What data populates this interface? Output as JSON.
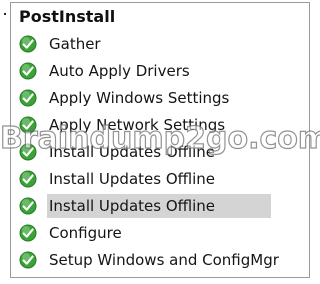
{
  "task_sequence": {
    "group_title": "PostInstall",
    "steps": [
      {
        "label": "Gather",
        "status_icon": "check-circle-icon",
        "selected": false
      },
      {
        "label": "Auto Apply Drivers",
        "status_icon": "check-circle-icon",
        "selected": false
      },
      {
        "label": "Apply Windows Settings",
        "status_icon": "check-circle-icon",
        "selected": false
      },
      {
        "label": "Apply Network Settings",
        "status_icon": "check-circle-icon",
        "selected": false
      },
      {
        "label": "Install Updates Offline",
        "status_icon": "check-circle-icon",
        "selected": false
      },
      {
        "label": "Install Updates Offline",
        "status_icon": "check-circle-icon",
        "selected": false
      },
      {
        "label": "Install Updates Offline",
        "status_icon": "check-circle-icon",
        "selected": true
      },
      {
        "label": "Configure",
        "status_icon": "check-circle-icon",
        "selected": false
      },
      {
        "label": "Setup Windows and ConfigMgr",
        "status_icon": "check-circle-icon",
        "selected": false
      }
    ],
    "selection_color": "#d4d4d4",
    "icon_color": "#3aa336"
  },
  "watermark": {
    "text": "Braindump2go.com"
  }
}
